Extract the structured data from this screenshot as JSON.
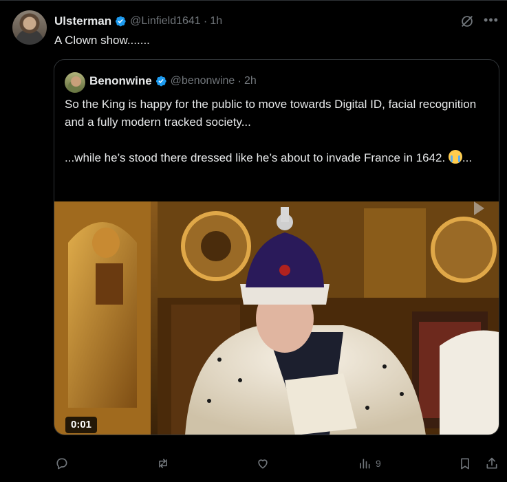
{
  "post": {
    "author_name": "Ulsterman",
    "author_handle": "@Linfield1641",
    "separator": "·",
    "time": "1h",
    "text": "A Clown show......."
  },
  "quoted": {
    "author_name": "Benonwine",
    "author_handle": "@benonwine",
    "separator": "·",
    "time": "2h",
    "text_line1": "So the King is happy for the public to move towards Digital ID, facial recognition and a fully modern tracked society...",
    "text_line2": "...while he’s stood there dressed like he’s about to invade France in 1642.",
    "text_line2_tail": "...",
    "emoji": "loudly-crying-face",
    "video_time": "0:01"
  },
  "actions": {
    "reply_count": "",
    "repost_count": "",
    "like_count": "",
    "views_count": "9"
  },
  "colors": {
    "background": "#000000",
    "text_primary": "#e7e9ea",
    "text_secondary": "#71767b",
    "verified": "#1d9bf0",
    "border": "#2f3336"
  },
  "icons": [
    "grok-icon",
    "more-icon",
    "verified-badge-icon",
    "reply-icon",
    "repost-icon",
    "like-icon",
    "views-icon",
    "bookmark-icon",
    "share-icon"
  ]
}
